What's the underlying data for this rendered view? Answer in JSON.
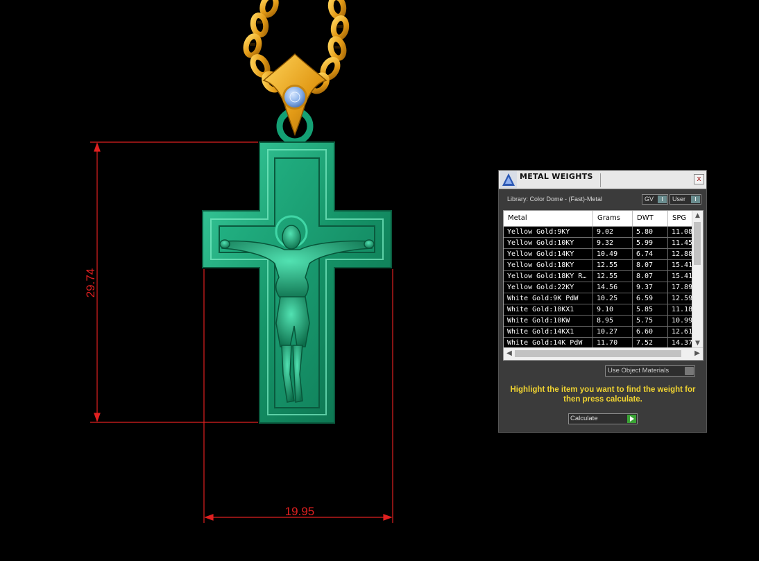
{
  "dimensions": {
    "height": "29.74",
    "width": "19.95"
  },
  "panel": {
    "title": "METAL WEIGHTS",
    "close_label": "x",
    "library_label": "Library: Color Dome - (Fast)-Metal",
    "gv_label": "GV",
    "user_label": "User",
    "toggle_knob": "I",
    "columns": [
      "Metal",
      "Grams",
      "DWT",
      "SPG"
    ],
    "rows": [
      [
        "Yellow Gold:9KY",
        "9.02",
        "5.80",
        "11.08"
      ],
      [
        "Yellow Gold:10KY",
        "9.32",
        "5.99",
        "11.45"
      ],
      [
        "Yellow Gold:14KY",
        "10.49",
        "6.74",
        "12.88"
      ],
      [
        "Yellow Gold:18KY",
        "12.55",
        "8.07",
        "15.41"
      ],
      [
        "Yellow Gold:18KY R…",
        "12.55",
        "8.07",
        "15.41"
      ],
      [
        "Yellow Gold:22KY",
        "14.56",
        "9.37",
        "17.89"
      ],
      [
        "White Gold:9K PdW",
        "10.25",
        "6.59",
        "12.59"
      ],
      [
        "White Gold:10KX1",
        "9.10",
        "5.85",
        "11.18"
      ],
      [
        "White Gold:10KW",
        "8.95",
        "5.75",
        "10.99"
      ],
      [
        "White Gold:14KX1",
        "10.27",
        "6.60",
        "12.61"
      ],
      [
        "White Gold:14K PdW",
        "11.70",
        "7.52",
        "14.37"
      ]
    ],
    "use_object_label": "Use Object Materials",
    "hint": "Highlight the item you want to find the weight for then press calculate.",
    "calculate_label": "Calculate"
  },
  "colors": {
    "dimension_line": "#e02020",
    "cross": "#1f9e73",
    "chain": "#e0a21a",
    "gem": "#8fb5ef",
    "hint_text": "#f2d531"
  }
}
